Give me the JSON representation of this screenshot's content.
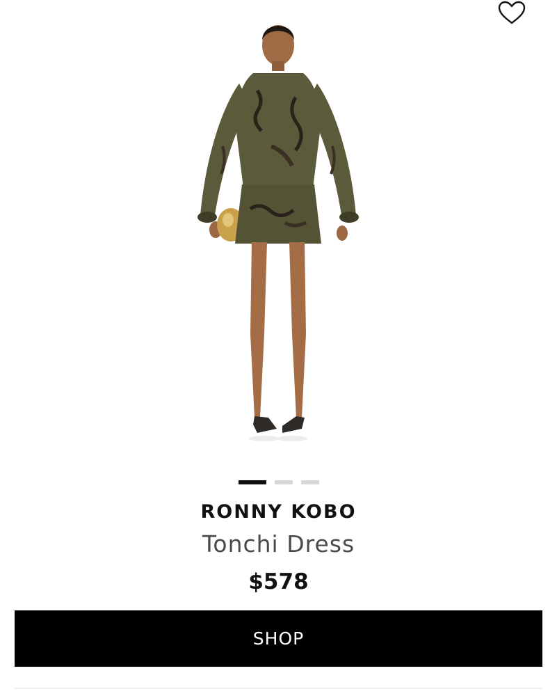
{
  "product": {
    "brand": "RONNY KOBO",
    "name": "Tonchi Dress",
    "price": "$578",
    "image_alt": "model wearing olive printed long-sleeve mini dress"
  },
  "carousel": {
    "total": 3,
    "active_index": 0
  },
  "actions": {
    "shop_label": "SHOP",
    "wishlist_icon": "heart-outline-icon"
  },
  "colors": {
    "button_bg": "#000000",
    "button_text": "#ffffff",
    "dot_active": "#111111",
    "dot_inactive": "#d8d8d8",
    "dress": "#5b5a3a"
  }
}
